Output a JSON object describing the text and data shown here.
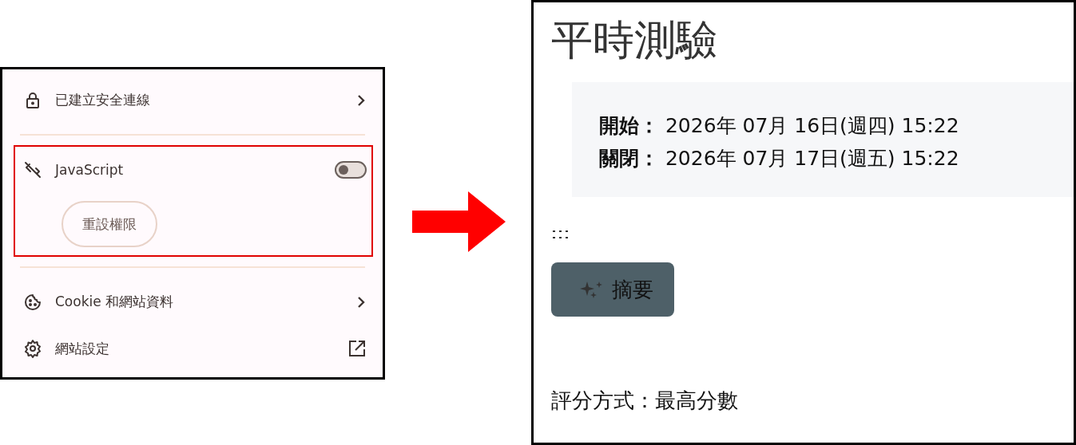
{
  "site_panel": {
    "items": [
      {
        "kind": "nav",
        "label": "已建立安全連線"
      },
      {
        "kind": "toggle",
        "label": "JavaScript",
        "on": false,
        "highlighted": true,
        "button": "重設權限"
      },
      {
        "kind": "nav",
        "label": "Cookie 和網站資料"
      },
      {
        "kind": "external",
        "label": "網站設定"
      }
    ]
  },
  "quiz_page": {
    "title": "平時測驗",
    "schedule": [
      "**開始：** 2026年 07月 16日(週四) 15:22",
      "**關閉：** 2026年 07月 17日(週五) 15:22"
    ],
    "summary_button": "摘要",
    "grading": "評分方式：最高分數"
  }
}
